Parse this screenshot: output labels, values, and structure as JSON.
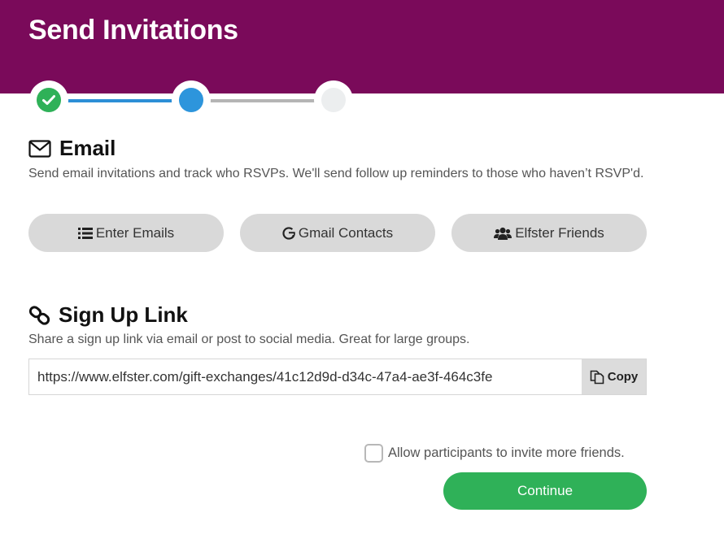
{
  "header": {
    "title": "Send Invitations",
    "background": "#7a0a5a"
  },
  "stepper": {
    "steps": [
      {
        "state": "complete",
        "icon": "check-icon",
        "color": "#2fb158"
      },
      {
        "state": "current",
        "color": "#2d95dc"
      },
      {
        "state": "upcoming",
        "color": "#eceeef"
      }
    ]
  },
  "email": {
    "title": "Email",
    "icon": "envelope-icon",
    "description": "Send email invitations and track who RSVPs. We'll send follow up reminders to those who haven’t RSVP'd.",
    "buttons": [
      {
        "label": "Enter Emails",
        "icon": "list-icon"
      },
      {
        "label": "Gmail Contacts",
        "icon": "google-icon"
      },
      {
        "label": "Elfster Friends",
        "icon": "users-icon"
      }
    ]
  },
  "signup": {
    "title": "Sign Up Link",
    "icon": "link-icon",
    "description": "Share a sign up link via email or post to social media. Great for large groups.",
    "url": "https://www.elfster.com/gift-exchanges/41c12d9d-d34c-47a4-ae3f-464c3fe",
    "copy_label": "Copy"
  },
  "allow_more": {
    "label": "Allow participants to invite more friends.",
    "checked": false
  },
  "continue_label": "Continue",
  "colors": {
    "accent_green": "#2fb158",
    "accent_blue": "#2d95dc"
  }
}
